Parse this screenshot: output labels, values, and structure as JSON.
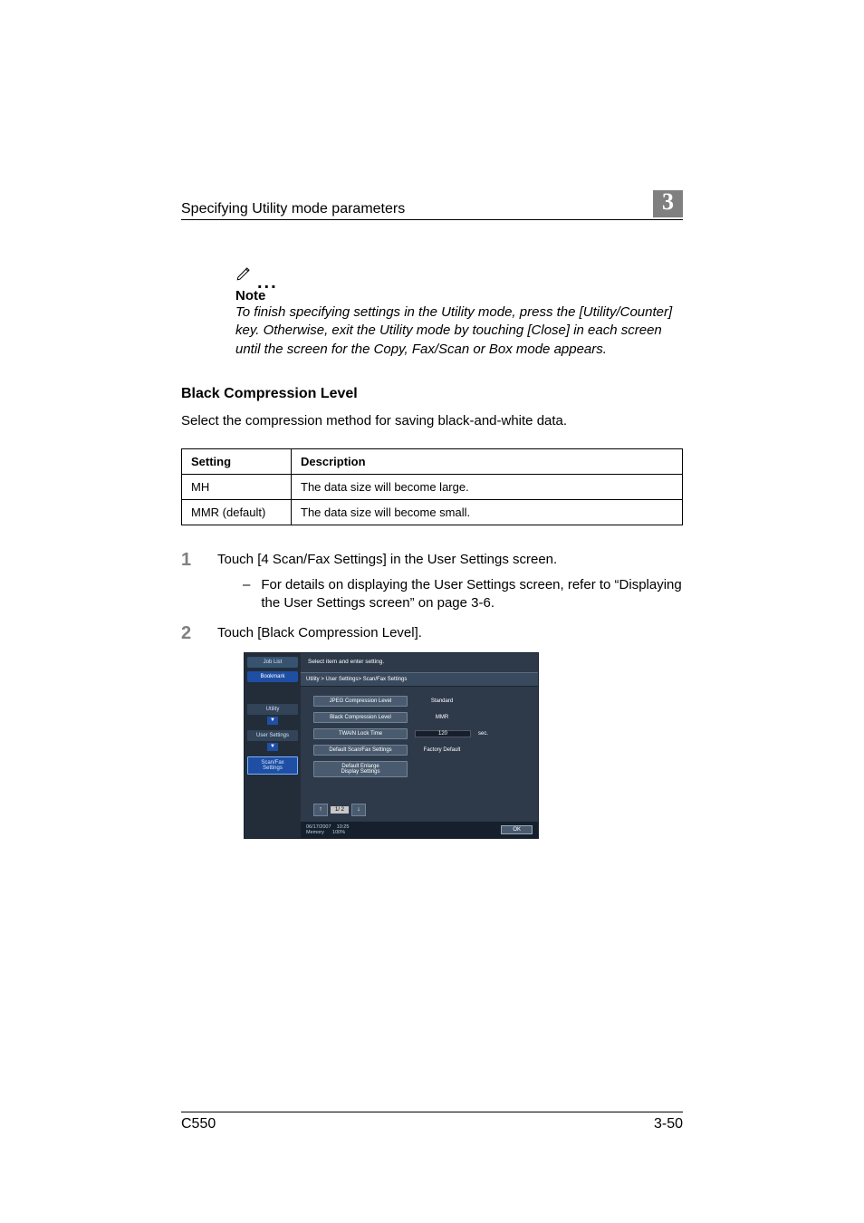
{
  "header": {
    "title": "Specifying Utility mode parameters",
    "chapter": "3"
  },
  "note": {
    "label": "Note",
    "text": "To finish specifying settings in the Utility mode, press the [Utility/Counter] key. Otherwise, exit the Utility mode by touching [Close] in each screen until the screen for the Copy, Fax/Scan or Box mode appears."
  },
  "section": {
    "heading": "Black Compression Level",
    "intro": "Select the compression method for saving black-and-white data."
  },
  "table": {
    "head_setting": "Setting",
    "head_description": "Description",
    "rows": [
      {
        "setting": "MH",
        "description": "The data size will become large."
      },
      {
        "setting": "MMR (default)",
        "description": "The data size will become small."
      }
    ]
  },
  "steps": {
    "s1": {
      "num": "1",
      "text": "Touch [4 Scan/Fax Settings] in the User Settings screen.",
      "sub": "For details on displaying the User Settings screen, refer to “Displaying the User Settings screen” on page 3-6."
    },
    "s2": {
      "num": "2",
      "text": "Touch [Black Compression Level]."
    }
  },
  "ui": {
    "joblist": "Job List",
    "bookmark": "Bookmark",
    "utility": "Utility",
    "user_settings": "User Settings",
    "scanfax": "Scan/Fax\nSettings",
    "prompt": "Select item and enter setting.",
    "breadcrumb": "Utility > User Settings> Scan/Fax Settings",
    "rows": {
      "r1_label": "JPEG Compression Level",
      "r1_val": "Standard",
      "r2_label": "Black Compression Level",
      "r2_val": "MMR",
      "r3_label": "TWAIN Lock Time",
      "r3_val": "120",
      "r3_unit": "sec.",
      "r4_label": "Default Scan/Fax Settings",
      "r4_val": "Factory Default",
      "r5_label": "Default Enlarge\nDisplay Settings"
    },
    "pager": "1/ 2",
    "date": "06/17/2007",
    "time": "10:25",
    "memory_label": "Memory",
    "memory_val": "100%",
    "ok": "OK"
  },
  "footer": {
    "model": "C550",
    "page": "3-50"
  }
}
